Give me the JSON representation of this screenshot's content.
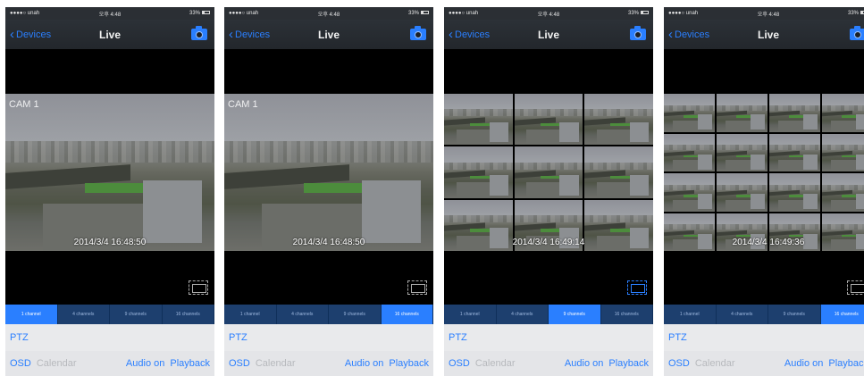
{
  "screens": [
    {
      "status": {
        "carrier": "●●●●○ unah",
        "time": "오후 4:48",
        "battery": "33%"
      },
      "nav": {
        "back": "Devices",
        "title": "Live"
      },
      "video": {
        "layout": "single",
        "cam_label": "CAM 1",
        "timestamp": "2014/3/4 16:48:50"
      },
      "channels": [
        "1 channel",
        "4 channels",
        "9 channels",
        "16 channels"
      ],
      "active_channel": 0,
      "ptz": "PTZ",
      "bottom": {
        "osd": "OSD",
        "calendar": "Calendar",
        "audio": "Audio on",
        "playback": "Playback"
      }
    },
    {
      "status": {
        "carrier": "●●●●○ unah",
        "time": "오후 4:48",
        "battery": "33%"
      },
      "nav": {
        "back": "Devices",
        "title": "Live"
      },
      "video": {
        "layout": "single",
        "cam_label": "CAM 1",
        "timestamp": "2014/3/4 16:48:50"
      },
      "channels": [
        "1 channel",
        "4 channels",
        "9 channels",
        "16 channels"
      ],
      "active_channel": 3,
      "ptz": "PTZ",
      "bottom": {
        "osd": "OSD",
        "calendar": "Calendar",
        "audio": "Audio on",
        "playback": "Playback"
      }
    },
    {
      "status": {
        "carrier": "●●●●○ unah",
        "time": "오후 4:48",
        "battery": "33%"
      },
      "nav": {
        "back": "Devices",
        "title": "Live"
      },
      "video": {
        "layout": "grid9",
        "timestamp": "2014/3/4 16:49:14"
      },
      "channels": [
        "1 channel",
        "4 channels",
        "9 channels",
        "16 channels"
      ],
      "active_channel": 2,
      "ptz": "PTZ",
      "bottom": {
        "osd": "OSD",
        "calendar": "Calendar",
        "audio": "Audio on",
        "playback": "Playback"
      }
    },
    {
      "status": {
        "carrier": "●●●●○ unah",
        "time": "오후 4:48",
        "battery": "33%"
      },
      "nav": {
        "back": "Devices",
        "title": "Live"
      },
      "video": {
        "layout": "grid16",
        "timestamp": "2014/3/4 16:49:36"
      },
      "channels": [
        "1 channel",
        "4 channels",
        "9 channels",
        "16 channels"
      ],
      "active_channel": 3,
      "ptz": "PTZ",
      "bottom": {
        "osd": "OSD",
        "calendar": "Calendar",
        "audio": "Audio on",
        "playback": "Playback"
      }
    }
  ],
  "colors": {
    "accent": "#2a7fff",
    "navbar": "#2c3137",
    "panel": "#e9eaec"
  }
}
